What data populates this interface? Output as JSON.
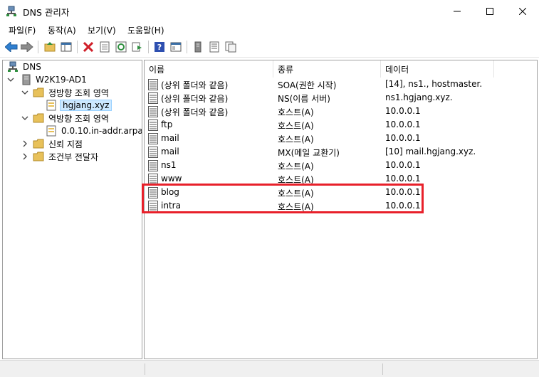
{
  "window": {
    "title": "DNS 관리자",
    "controls": {
      "minimize": "minimize",
      "maximize": "maximize",
      "close": "close"
    }
  },
  "menu": [
    "파일(F)",
    "동작(A)",
    "보기(V)",
    "도움말(H)"
  ],
  "toolbar": [
    "back-icon",
    "forward-icon",
    "up-folder-icon",
    "show-hide-tree-icon",
    "delete-icon",
    "properties-icon",
    "refresh-icon",
    "export-list-icon",
    "help-icon",
    "console-view-icon",
    "server-icon",
    "list-icon",
    "copy-icon"
  ],
  "tree": {
    "root": "DNS",
    "server": "W2K19-AD1",
    "forward_zones": "정방향 조회 영역",
    "zone": "hgjang.xyz",
    "reverse_zones": "역방향 조회 영역",
    "reverse_zone": "0.0.10.in-addr.arpa",
    "trust_points": "신뢰 지점",
    "conditional_forwarders": "조건부 전달자"
  },
  "columns": {
    "name": "이름",
    "type": "종류",
    "data": "데이터"
  },
  "records": [
    {
      "name": "(상위 폴더와 같음)",
      "type": "SOA(권한 시작)",
      "data": "[14], ns1., hostmaster."
    },
    {
      "name": "(상위 폴더와 같음)",
      "type": "NS(이름 서버)",
      "data": "ns1.hgjang.xyz."
    },
    {
      "name": "(상위 폴더와 같음)",
      "type": "호스트(A)",
      "data": "10.0.0.1"
    },
    {
      "name": "ftp",
      "type": "호스트(A)",
      "data": "10.0.0.1"
    },
    {
      "name": "mail",
      "type": "호스트(A)",
      "data": "10.0.0.1"
    },
    {
      "name": "mail",
      "type": "MX(메일 교환기)",
      "data": "[10]  mail.hgjang.xyz."
    },
    {
      "name": "ns1",
      "type": "호스트(A)",
      "data": "10.0.0.1"
    },
    {
      "name": "www",
      "type": "호스트(A)",
      "data": "10.0.0.1"
    },
    {
      "name": "blog",
      "type": "호스트(A)",
      "data": "10.0.0.1"
    },
    {
      "name": "intra",
      "type": "호스트(A)",
      "data": "10.0.0.1"
    }
  ],
  "colors": {
    "highlight_box": "#e8202a",
    "selected_zone_bg": "#cce8ff",
    "folder": "#e8c15a"
  }
}
